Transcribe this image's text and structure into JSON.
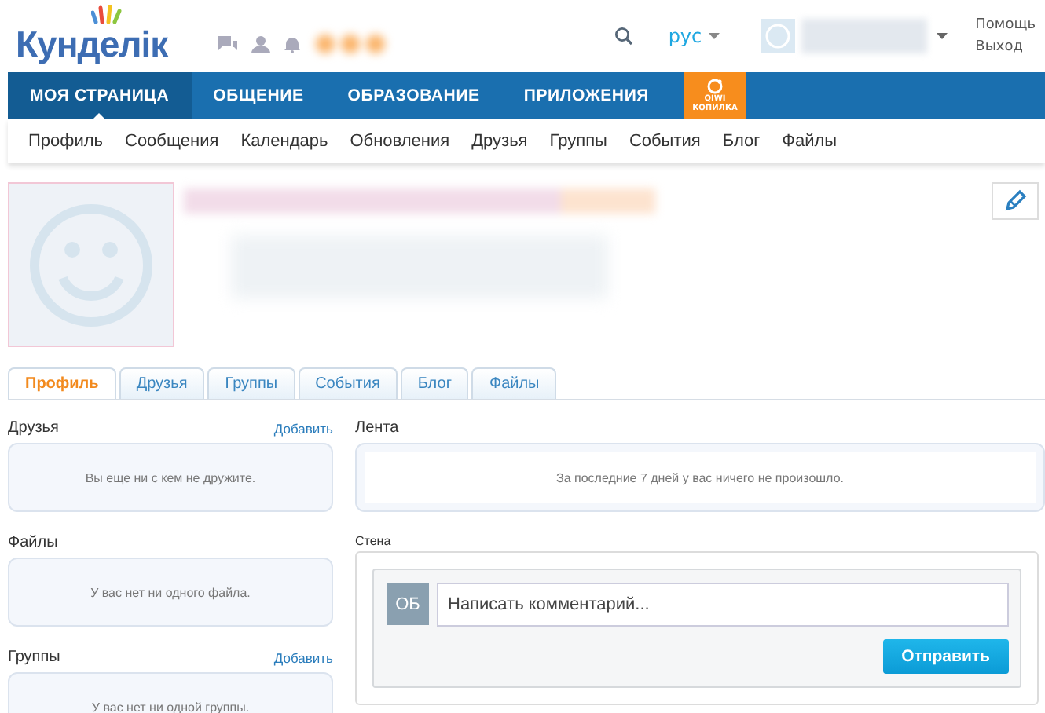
{
  "header": {
    "logo": "Кунделік",
    "language": "рус",
    "links": [
      "Помощь",
      "Выход"
    ]
  },
  "nav": {
    "items": [
      {
        "label": "МОЯ СТРАНИЦА",
        "selected": true
      },
      {
        "label": "ОБЩЕНИЕ",
        "selected": false
      },
      {
        "label": "ОБРАЗОВАНИЕ",
        "selected": false
      },
      {
        "label": "ПРИЛОЖЕНИЯ",
        "selected": false
      }
    ],
    "promo": {
      "line1": "QIWI",
      "line2": "КОПИЛКА"
    }
  },
  "subnav": [
    "Профиль",
    "Сообщения",
    "Календарь",
    "Обновления",
    "Друзья",
    "Группы",
    "События",
    "Блог",
    "Файлы"
  ],
  "profile_tabs": [
    {
      "label": "Профиль",
      "selected": true
    },
    {
      "label": "Друзья",
      "selected": false
    },
    {
      "label": "Группы",
      "selected": false
    },
    {
      "label": "События",
      "selected": false
    },
    {
      "label": "Блог",
      "selected": false
    },
    {
      "label": "Файлы",
      "selected": false
    }
  ],
  "left_sections": [
    {
      "title": "Друзья",
      "action": "Добавить",
      "message": "Вы еще ни с кем не дружите."
    },
    {
      "title": "Файлы",
      "message": "У вас нет ни одного файла."
    },
    {
      "title": "Группы",
      "action": "Добавить",
      "message": "У вас нет ни одной группы."
    }
  ],
  "feed": {
    "title": "Лента",
    "message": "За последние 7 дней у вас ничего не произошло."
  },
  "wall": {
    "title": "Стена",
    "avatar_initials": "ОБ",
    "comment": {
      "placeholder": "Написать комментарий..."
    },
    "submit": "Отправить"
  }
}
